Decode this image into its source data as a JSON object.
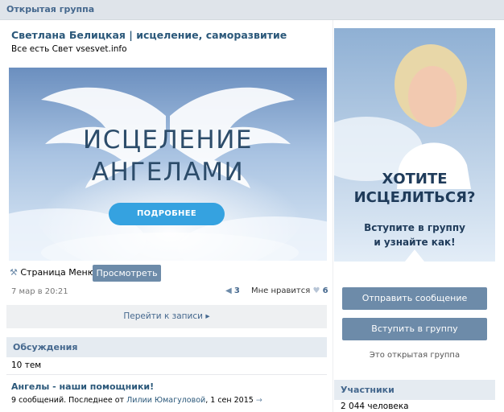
{
  "header": {
    "label": "Открытая группа"
  },
  "group": {
    "title": "Светлана Белицкая | исцеление, саморазвитие",
    "status": "Все есть Свет vsesvet.info"
  },
  "banner": {
    "line1": "ИСЦЕЛЕНИЕ",
    "line2": "АНГЕЛАМИ",
    "button": "ПОДРОБНЕЕ"
  },
  "menu": {
    "icon": "wrench-icon",
    "label": "Страница Меню",
    "view_button": "Просмотреть"
  },
  "post": {
    "date": "7 мар в 20:21",
    "shares": "3",
    "likes_label": "Мне нравится",
    "likes": "6",
    "goto": "Перейти к записи"
  },
  "discussions": {
    "title": "Обсуждения",
    "count": "10 тем",
    "topic_title": "Ангелы - наши помощники!",
    "topic_meta_prefix": "9 сообщений. Последнее от",
    "topic_author": "Лилии Юмагуловой",
    "topic_date": ", 1 сен 2015"
  },
  "promo": {
    "heading1": "ХОТИТЕ",
    "heading2": "ИСЦЕЛИТЬСЯ?",
    "sub1": "Вступите в группу",
    "sub2": "и узнайте как!"
  },
  "actions": {
    "send_message": "Отправить сообщение",
    "join": "Вступить в группу",
    "open_group": "Это открытая группа"
  },
  "members": {
    "title": "Участники",
    "count": "2 044 человека"
  },
  "colors": {
    "link": "#2b587a",
    "button": "#6d8ba9",
    "accent": "#35a2e0",
    "page_bg": "#edeef0"
  }
}
